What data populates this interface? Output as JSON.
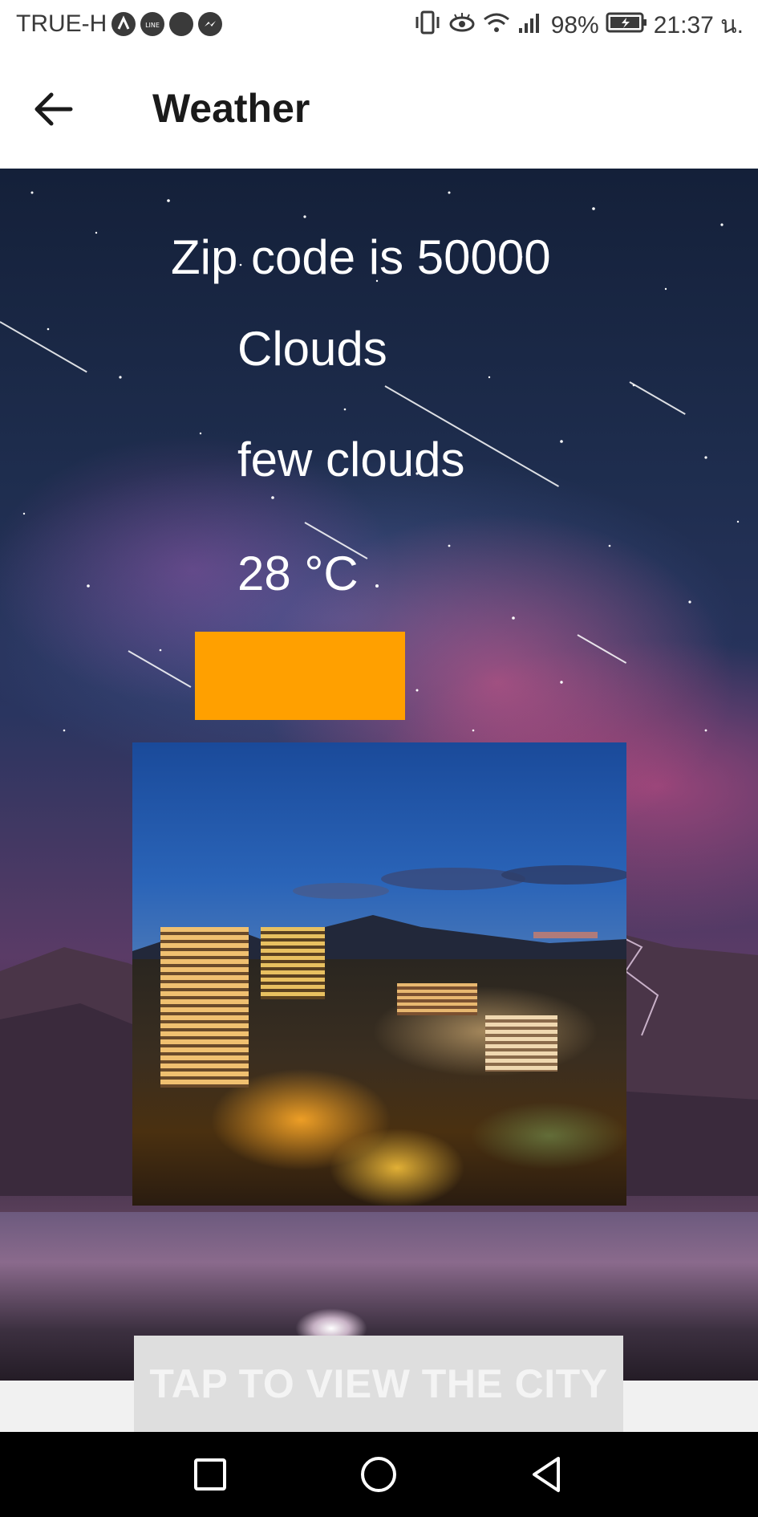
{
  "status_bar": {
    "carrier": "TRUE-H",
    "battery": "98%",
    "time": "21:37 น."
  },
  "app_bar": {
    "title": "Weather",
    "back_icon": "arrow-left-icon"
  },
  "weather": {
    "zip_text": "Zip code is 50000",
    "main": "Clouds",
    "description": "few clouds",
    "temperature": "28 °C"
  },
  "accent_color": "#ffa000",
  "city_button": {
    "label": "TAP TO VIEW THE CITY"
  },
  "nav_bar": {
    "icons": [
      "recent-apps-icon",
      "home-icon",
      "back-triangle-icon"
    ]
  }
}
